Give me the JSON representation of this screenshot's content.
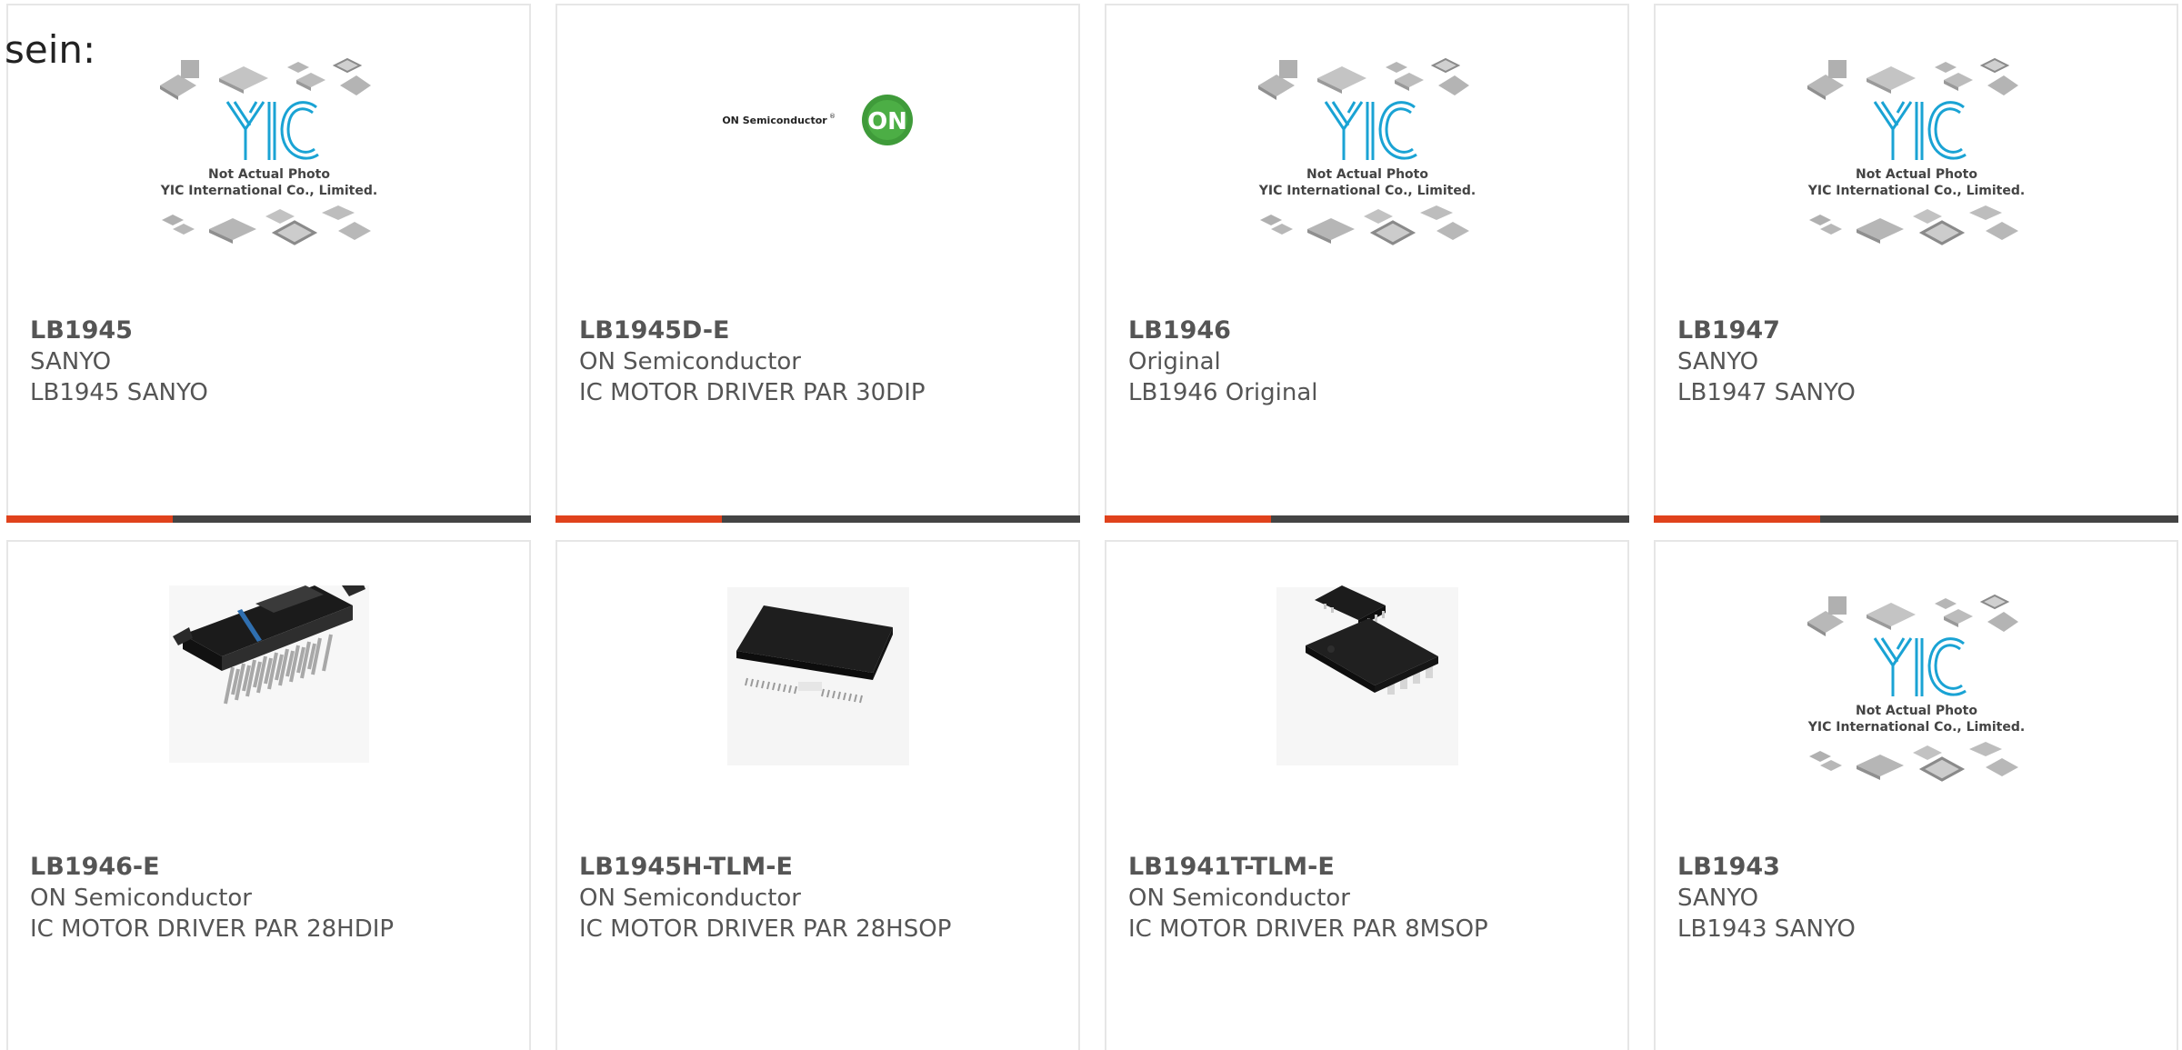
{
  "intro_text": "sein:",
  "placeholder_caption": {
    "logo": "YIC",
    "line1": "Not Actual Photo",
    "line2": "YIC International Co., Limited."
  },
  "on_logo": {
    "wordmark": "ON Semiconductor",
    "badge": "ON"
  },
  "colors": {
    "accent": "#e0421c",
    "bar": "#444444",
    "text": "#555555",
    "border": "#e6e6e6",
    "yic_blue": "#1aa3d4",
    "on_green": "#3f9b3a"
  },
  "products": [
    {
      "part": "LB1945",
      "brand": "SANYO",
      "desc": "LB1945 SANYO",
      "image": "yic-placeholder"
    },
    {
      "part": "LB1945D-E",
      "brand": "ON Semiconductor",
      "desc": "IC MOTOR DRIVER PAR 30DIP",
      "image": "on-semiconductor-logo"
    },
    {
      "part": "LB1946",
      "brand": "Original",
      "desc": "LB1946 Original",
      "image": "yic-placeholder"
    },
    {
      "part": "LB1947",
      "brand": "SANYO",
      "desc": "LB1947 SANYO",
      "image": "yic-placeholder"
    },
    {
      "part": "LB1946-E",
      "brand": "ON Semiconductor",
      "desc": "IC MOTOR DRIVER PAR 28HDIP",
      "image": "hdip-chip-photo"
    },
    {
      "part": "LB1945H-TLM-E",
      "brand": "ON Semiconductor",
      "desc": "IC MOTOR DRIVER PAR 28HSOP",
      "image": "hsop-chip-photo"
    },
    {
      "part": "LB1941T-TLM-E",
      "brand": "ON Semiconductor",
      "desc": "IC MOTOR DRIVER PAR 8MSOP",
      "image": "msop-chip-photo"
    },
    {
      "part": "LB1943",
      "brand": "SANYO",
      "desc": "LB1943 SANYO",
      "image": "yic-placeholder"
    }
  ]
}
